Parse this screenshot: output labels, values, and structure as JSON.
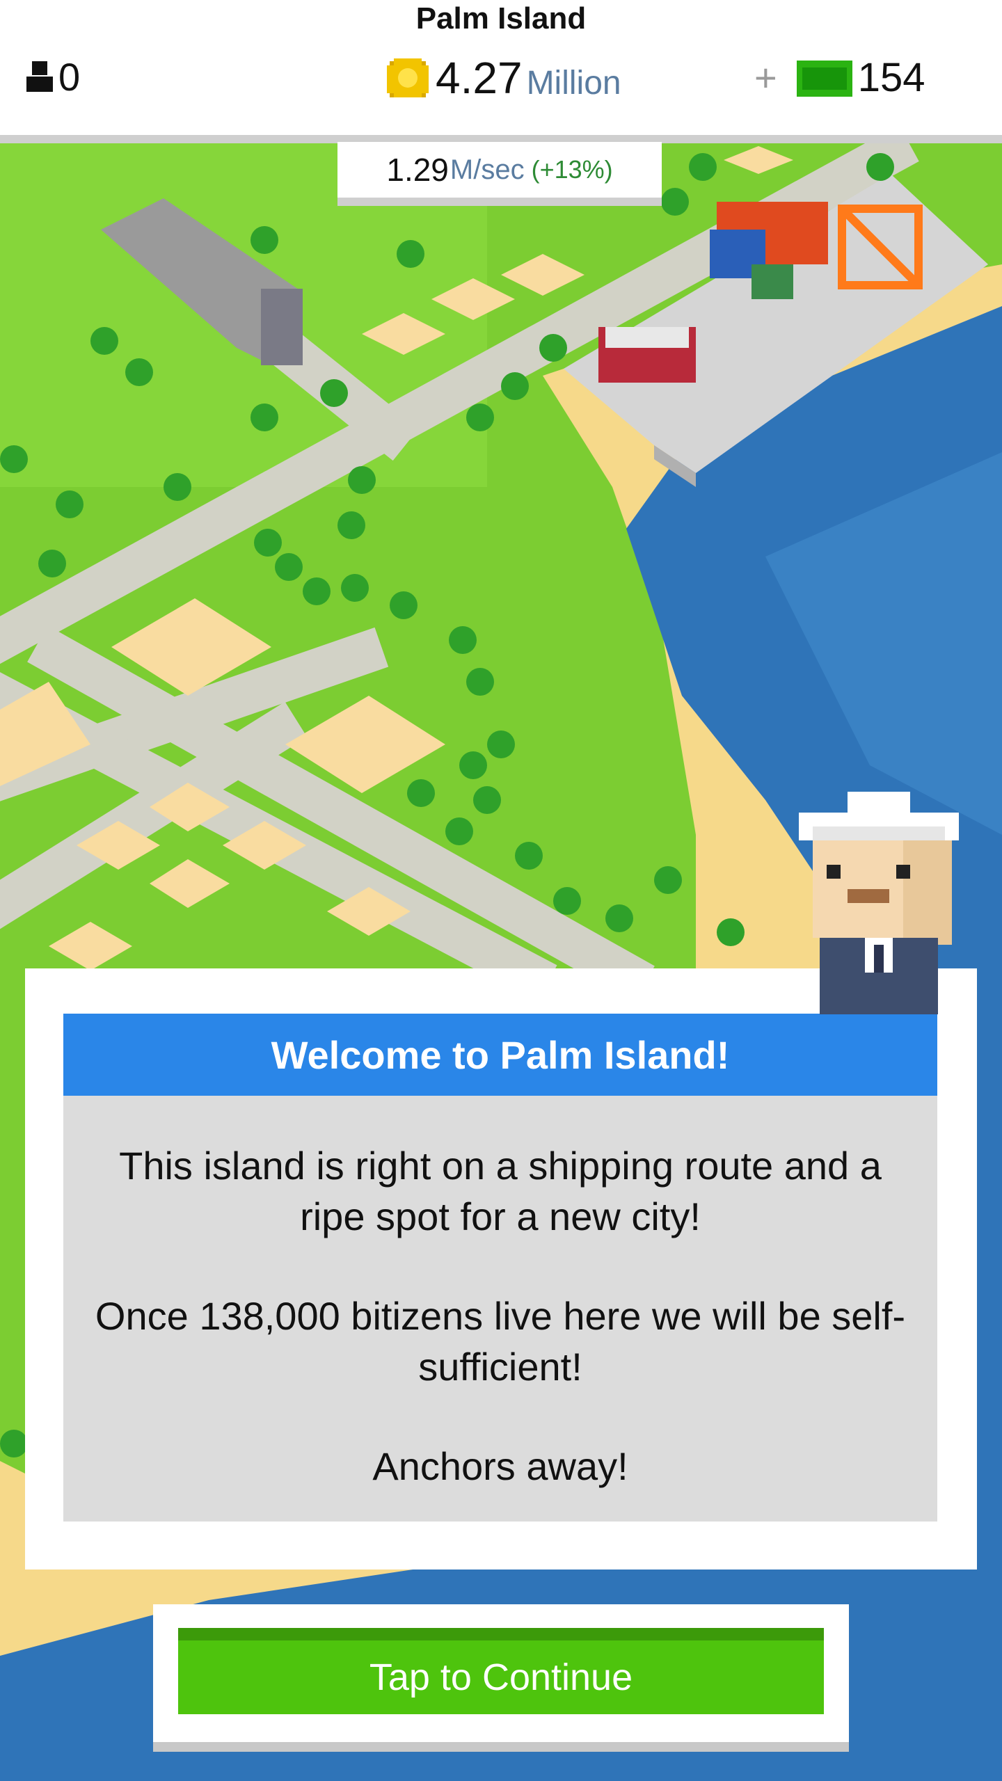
{
  "header": {
    "island_name": "Palm Island",
    "population": "0",
    "coins_value": "4.27",
    "coins_unit": "Million",
    "cash_plus": "+",
    "cash_value": "154",
    "rate_value": "1.29",
    "rate_unit": "M/sec",
    "rate_change": "(+13%)"
  },
  "icons": {
    "population": "person-icon",
    "coins": "coin-icon",
    "cash": "cash-bill-icon"
  },
  "dialog": {
    "title": "Welcome to Palm Island!",
    "paragraph_1": "This island is right on a shipping route and a ripe spot for a new city!",
    "paragraph_2": "Once 138,000 bitizens live here we will be self-sufficient!",
    "paragraph_3": "Anchors away!"
  },
  "continue_button": "Tap to Continue",
  "colors": {
    "grass": "#7ccd32",
    "sand": "#f6d98a",
    "water": "#2f74b8",
    "header_blue": "#2a86e8",
    "button_green": "#4ec40d"
  }
}
